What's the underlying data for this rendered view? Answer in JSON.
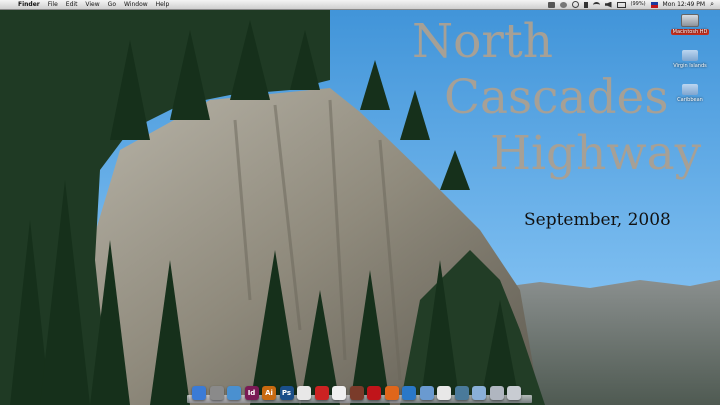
{
  "menubar": {
    "apple_glyph": "",
    "items": [
      "Finder",
      "File",
      "Edit",
      "View",
      "Go",
      "Window",
      "Help"
    ],
    "battery": "(99%)",
    "clock": "Mon 12:49 PM"
  },
  "wallpaper": {
    "title_lines": [
      "North",
      "Cascades",
      "Highway"
    ],
    "subtitle": "September, 2008"
  },
  "desktop_icons": [
    {
      "label": "Macintosh HD",
      "icon": "hard-drive-icon"
    },
    {
      "label": "Virgin Islands",
      "icon": "folder-icon"
    },
    {
      "label": "Caribbean",
      "icon": "folder-icon"
    }
  ],
  "dock": {
    "items": [
      {
        "icon": "finder-icon",
        "glyph": "",
        "color": "#3b7bd6"
      },
      {
        "icon": "system-preferences-icon",
        "glyph": "",
        "color": "#8a8a8a"
      },
      {
        "icon": "safari-icon",
        "glyph": "",
        "color": "#4a90d0"
      },
      {
        "icon": "indesign-icon",
        "glyph": "Id",
        "color": "#7a1a55"
      },
      {
        "icon": "illustrator-icon",
        "glyph": "Ai",
        "color": "#c86a10"
      },
      {
        "icon": "photoshop-icon",
        "glyph": "Ps",
        "color": "#1a4f8a"
      },
      {
        "icon": "acrobat-icon",
        "glyph": "",
        "color": "#e8e8e8"
      },
      {
        "icon": "acrobat-pro-icon",
        "glyph": "",
        "color": "#cc2222"
      },
      {
        "icon": "textedit-icon",
        "glyph": "",
        "color": "#f0f0f0"
      },
      {
        "icon": "photo-booth-icon",
        "glyph": "",
        "color": "#7a3b2a"
      },
      {
        "icon": "dictionary-icon",
        "glyph": "",
        "color": "#c0141a"
      },
      {
        "icon": "firefox-icon",
        "glyph": "",
        "color": "#e0661b"
      },
      {
        "icon": "app-store-icon",
        "glyph": "",
        "color": "#2a78c8"
      },
      {
        "icon": "network-icon",
        "glyph": "",
        "color": "#6a9ad0"
      },
      {
        "icon": "calendar-icon",
        "glyph": "",
        "color": "#e8e8e8"
      },
      {
        "icon": "iphoto-icon",
        "glyph": "",
        "color": "#4a7a9a"
      },
      {
        "icon": "applications-folder-icon",
        "glyph": "",
        "color": "#8ab0d8"
      },
      {
        "icon": "downloads-stack-icon",
        "glyph": "",
        "color": "#b0b6c0"
      },
      {
        "icon": "trash-icon",
        "glyph": "",
        "color": "#c8ccd2"
      }
    ]
  },
  "colors": {
    "sky": "#5aa7e3",
    "title_grey": "#a6a096",
    "selected_label": "#c9301f"
  }
}
